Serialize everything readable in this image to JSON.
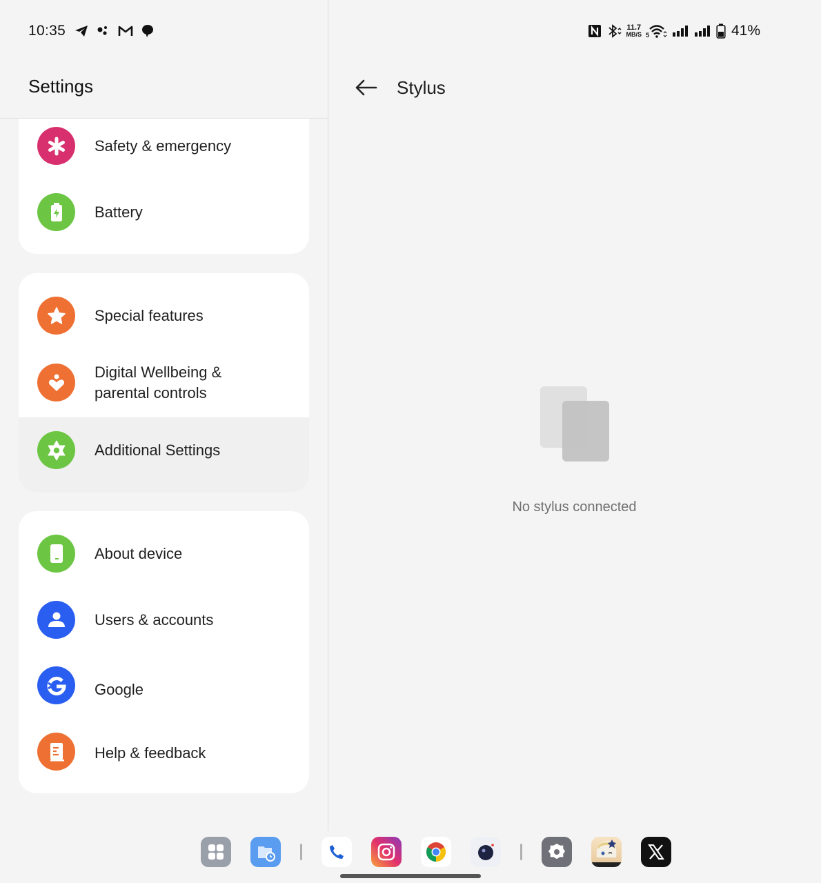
{
  "status_bar": {
    "time": "10:35",
    "left_icons": [
      "telegram-icon",
      "assistant-dots-icon",
      "gmail-icon",
      "chat-bubble-icon"
    ],
    "right_icons": [
      "nfc-icon",
      "bluetooth-icon",
      "wifi-icon",
      "signal-icon",
      "signal-icon",
      "battery-icon"
    ],
    "net_speed_value": "11.7",
    "net_speed_unit": "MB/S",
    "wifi_badge": "5",
    "battery_percent": "41%"
  },
  "left_pane": {
    "title": "Settings",
    "groups": [
      {
        "items": [
          {
            "label": "Safety & emergency",
            "icon": "asterisk-icon",
            "color": "#d8306e"
          },
          {
            "label": "Battery",
            "icon": "battery-charging-icon",
            "color": "#6cc644"
          }
        ]
      },
      {
        "items": [
          {
            "label": "Special features",
            "icon": "star-icon",
            "color": "#ee7033"
          },
          {
            "label": "Digital Wellbeing & parental controls",
            "label_line1": "Digital Wellbeing &",
            "label_line2": "parental controls",
            "icon": "wellbeing-heart-icon",
            "color": "#ee7033"
          },
          {
            "label": "Additional Settings",
            "icon": "gear-icon",
            "color": "#6cc644",
            "selected": true
          }
        ]
      },
      {
        "items": [
          {
            "label": "About device",
            "icon": "phone-device-icon",
            "color": "#6cc644"
          },
          {
            "label": "Users & accounts",
            "icon": "person-icon",
            "color": "#2a5ef0"
          },
          {
            "label": "Google",
            "icon": "google-icon",
            "color": "#2a5ef0"
          },
          {
            "label": "Help & feedback",
            "icon": "book-icon",
            "color": "#ee7033"
          }
        ]
      }
    ]
  },
  "right_pane": {
    "title": "Stylus",
    "back_icon": "arrow-left-icon",
    "empty_state": "No stylus connected"
  },
  "dock": {
    "apps": [
      {
        "name": "app-drawer",
        "color": "#9aa0aa"
      },
      {
        "name": "files",
        "color": "#5a9cf0"
      },
      {
        "name": "phone",
        "color": "#ffffff"
      },
      {
        "name": "instagram",
        "color": "#e1306c"
      },
      {
        "name": "chrome",
        "color": "#ffffff"
      },
      {
        "name": "camera",
        "color": "#eef0f6"
      },
      {
        "name": "settings",
        "color": "#6f7078"
      },
      {
        "name": "game",
        "color": "#f3d9b4"
      },
      {
        "name": "x",
        "color": "#111111"
      }
    ]
  }
}
